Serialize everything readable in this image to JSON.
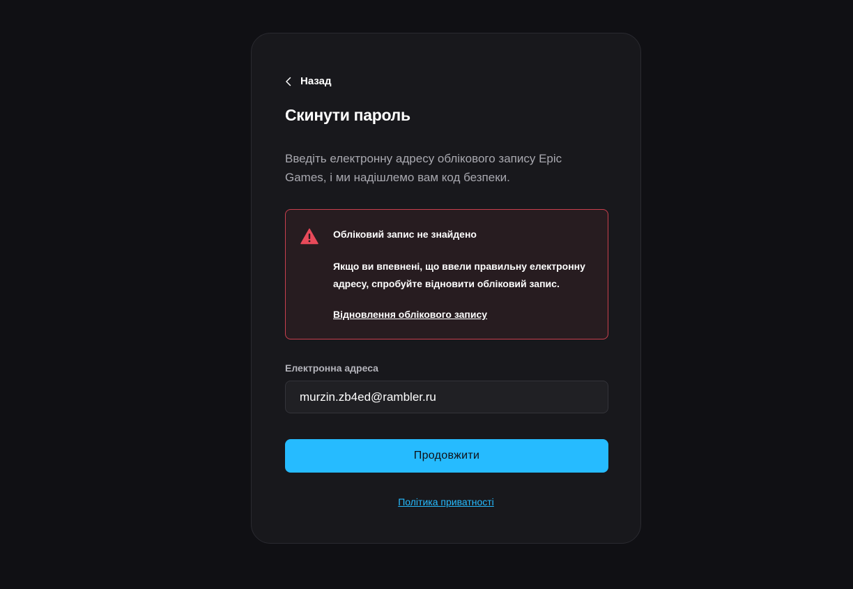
{
  "back": {
    "label": "Назад",
    "icon": "chevron-left-icon"
  },
  "title": "Скинути пароль",
  "description": "Введіть електронну адресу облікового запису Epic Games, і ми надішлемо вам код безпеки.",
  "alert": {
    "icon": "warning-triangle-icon",
    "title": "Обліковий запис не знайдено",
    "body": "Якщо ви впевнені, що ввели правильну електронну адресу, спробуйте відновити обліковий запис.",
    "link": "Відновлення облікового запису",
    "color": "#c9404e"
  },
  "email": {
    "label": "Електронна адреса",
    "value": "murzin.zb4ed@rambler.ru"
  },
  "submit": {
    "label": "Продовжити",
    "color": "#26bbff"
  },
  "privacy_link": "Політика приватності"
}
